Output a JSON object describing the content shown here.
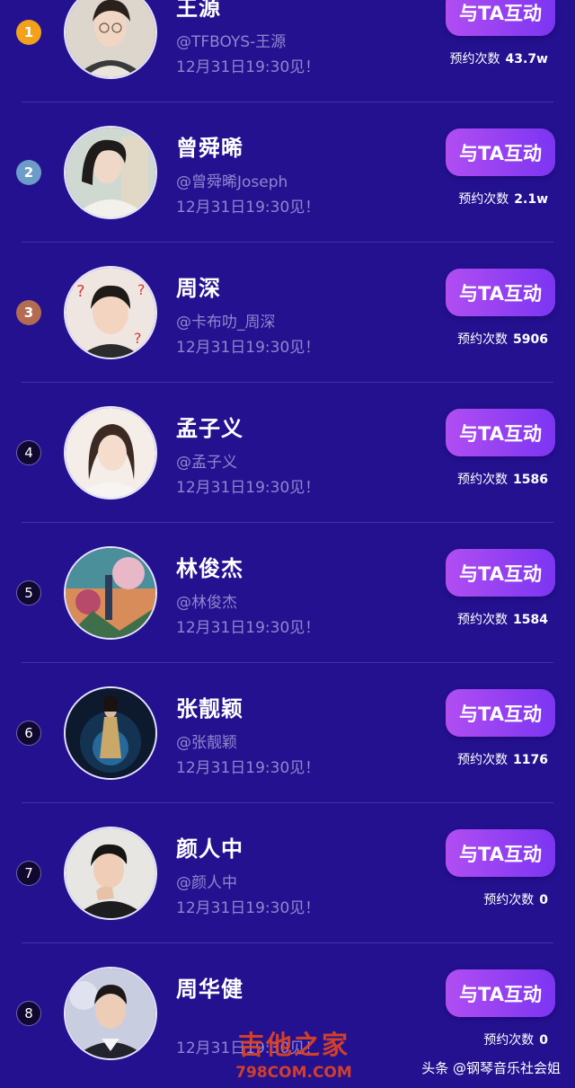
{
  "button_label": "与TA互动",
  "appointment_label": "预约次数",
  "rows": [
    {
      "rank": "1",
      "name": "王源",
      "handle": "@TFBOYS-王源",
      "time": "12月31日19:30见！",
      "count": "43.7w"
    },
    {
      "rank": "2",
      "name": "曾舜晞",
      "handle": "@曾舜晞Joseph",
      "time": "12月31日19:30见！",
      "count": "2.1w"
    },
    {
      "rank": "3",
      "name": "周深",
      "handle": "@卡布叻_周深",
      "time": "12月31日19:30见！",
      "count": "5906"
    },
    {
      "rank": "4",
      "name": "孟子义",
      "handle": "@孟子义",
      "time": "12月31日19:30见！",
      "count": "1586"
    },
    {
      "rank": "5",
      "name": "林俊杰",
      "handle": "@林俊杰",
      "time": "12月31日19:30见！",
      "count": "1584"
    },
    {
      "rank": "6",
      "name": "张靓颖",
      "handle": "@张靓颖",
      "time": "12月31日19:30见！",
      "count": "1176"
    },
    {
      "rank": "7",
      "name": "颜人中",
      "handle": "@颜人中",
      "time": "12月31日19:30见！",
      "count": "0"
    },
    {
      "rank": "8",
      "name": "周华健",
      "handle": "",
      "time": "12月31日19:30见！",
      "count": "0"
    }
  ],
  "colors": {
    "background": "#24118f",
    "rank_gold": "#f2a11a",
    "rank_silver": "#6e9cc8",
    "rank_bronze": "#b26c52",
    "button_start": "#b14ef2",
    "button_end": "#7b35f2"
  },
  "watermark": {
    "cn": "吉他之家",
    "en": "798COM.COM"
  },
  "source_label": "头条 @钢琴音乐社会姐"
}
